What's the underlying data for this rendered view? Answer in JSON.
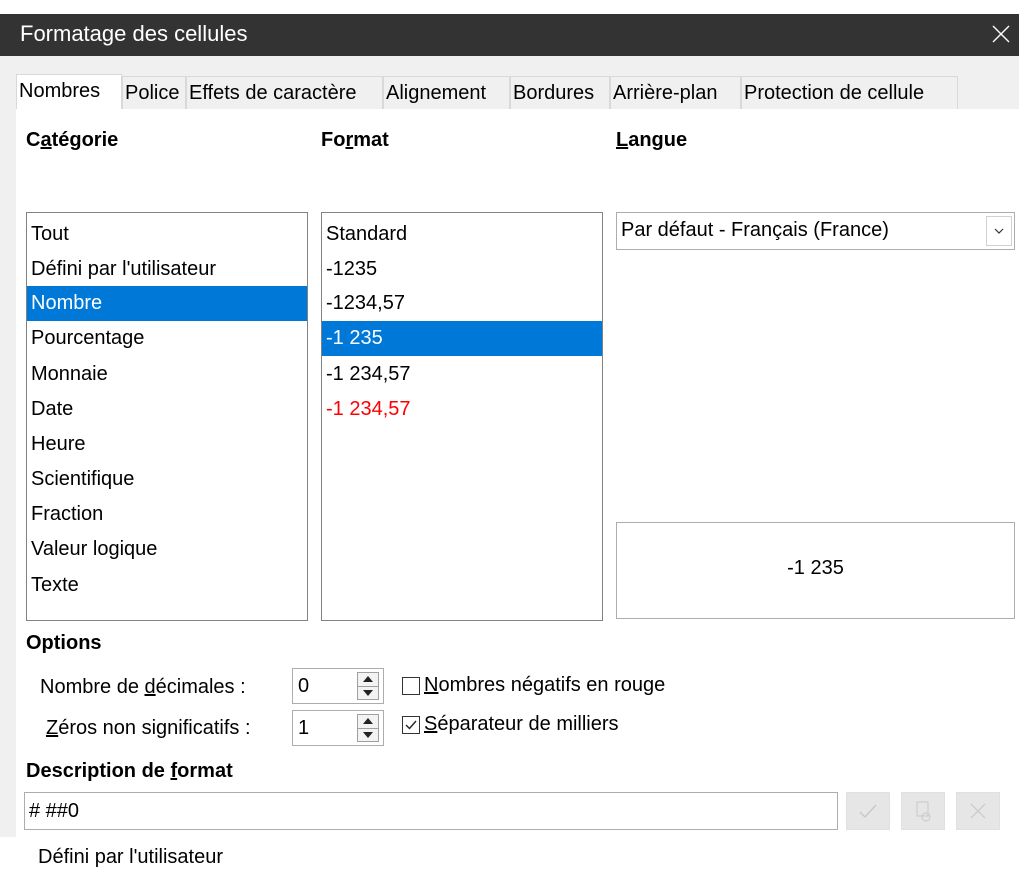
{
  "window": {
    "title": "Formatage des cellules",
    "close_icon": "close-icon"
  },
  "tabs": [
    {
      "label": "Nombres",
      "active": true
    },
    {
      "label": "Police"
    },
    {
      "label": "Effets de caractère"
    },
    {
      "label": "Alignement"
    },
    {
      "label": "Bordures"
    },
    {
      "label": "Arrière-plan"
    },
    {
      "label": "Protection de cellule"
    }
  ],
  "category": {
    "heading_pre": "C",
    "heading_u": "a",
    "heading_post": "tégorie",
    "items": [
      "Tout",
      "Défini par l'utilisateur",
      "Nombre",
      "Pourcentage",
      "Monnaie",
      "Date",
      "Heure",
      "Scientifique",
      "Fraction",
      "Valeur logique",
      "Texte"
    ],
    "selected": "Nombre"
  },
  "format": {
    "heading_pre": "Fo",
    "heading_u": "r",
    "heading_post": "mat",
    "items": [
      "Standard",
      "-1235",
      "-1234,57",
      "-1 235",
      "-1 234,57",
      "-1 234,57"
    ],
    "selected": "-1 235",
    "red_item_index": 5
  },
  "language": {
    "heading_u": "L",
    "heading_post": "angue",
    "value": "Par défaut - Français (France)"
  },
  "preview": {
    "value": "-1 235"
  },
  "options": {
    "heading": "Options",
    "decimals_label_pre": "Nombre de ",
    "decimals_label_u": "d",
    "decimals_label_post": "écimales :",
    "decimals_value": "0",
    "zeros_label_u": "Z",
    "zeros_label_post": "éros non significatifs :",
    "zeros_value": "1",
    "negative_red_u": "N",
    "negative_red_post": "ombres négatifs en rouge",
    "negative_red_checked": false,
    "thousands_u": "S",
    "thousands_post": "éparateur de milliers",
    "thousands_checked": true
  },
  "format_code": {
    "heading_pre": "Description de ",
    "heading_u": "f",
    "heading_post": "ormat",
    "value": "# ##0",
    "comment": "Défini par l'utilisateur"
  },
  "colors": {
    "accent": "#0078d7",
    "titlebar": "#333333",
    "dialog_bg": "#f0f0f0",
    "negative": "#ff0000"
  }
}
